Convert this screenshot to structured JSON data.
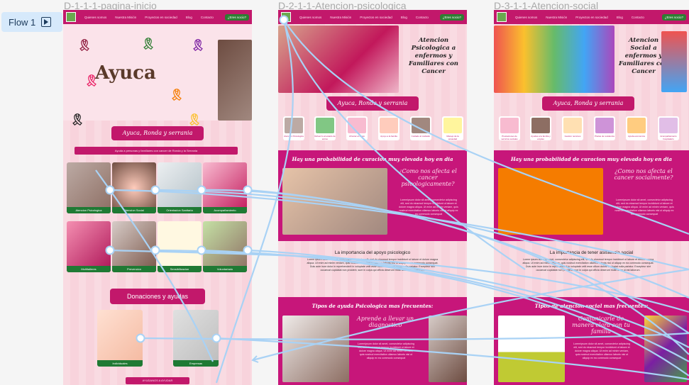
{
  "flow": {
    "label": "Flow 1"
  },
  "frames": {
    "home": {
      "title": "D-1-1-1-pagina-inicio"
    },
    "psych": {
      "title": "D-2-1-1-Atencion-psicologica"
    },
    "social": {
      "title": "D-3-1-1-Atencion-social"
    }
  },
  "nav": {
    "items": [
      "Quienes somos",
      "Nuestra Misión",
      "Proyectos en sociedad",
      "Blog",
      "Contacto"
    ],
    "cta": "¿Eres socio?"
  },
  "home": {
    "logo_text": "Ayuca",
    "banner": "Ayuca, Ronda y serrania",
    "subbanner": "Ayuda a personas y familiares con cancer de Ronda y la Serrania",
    "cards": [
      "Atencion Psicologica",
      "Atencion Social",
      "Orientacion Sanitaria",
      "Acompañamiento",
      "Multitaileres",
      "Prevencion",
      "Sensibilizacion",
      "Voluntariado"
    ],
    "donations_title": "Donaciones y ayudas",
    "donation_cards": [
      "Individuales",
      "Empresas"
    ],
    "footer_button": "AYUDANOS A AYUDAR"
  },
  "psych": {
    "hero_heading": "Atencion Psicologica a enfermos y Familiares con Cancer",
    "banner": "Ayuca, Ronda y serrania",
    "icon_labels": [
      "Atencion Psicologica",
      "Refuerzo al estado de animo",
      "Afrontar el duelo",
      "Apoyo a la familia",
      "Cuidado al cuidador",
      "Manejo de la ansiedad"
    ],
    "section1_title": "Hay una probabilidad de curacion muy elevada hoy en dia",
    "question": "¿Como nos afecta el cancer psicologicamente?",
    "lorem_short": "Loremipsum dolor sit amet, consectetur adipiscing elit, sed do eiusmod tempor incididunt ut labore et dolore magna aliqua. Ut enim ad minim veniam, quis nostrud exercitation ullamco laboris nisi ut aliquip ex ea commodo consequat",
    "section2_title": "La importancia del apoyo psicologico",
    "lorem_long": "Lorem ipsum dolor sit amet, consectetur adipiscing elit, sed do eiusmod tempor incididunt ut labore et dolore magna aliqua. Ut enim ad minim veniam, quis nostrud exercitation ullamco laboris nisi ut aliquip ex ea commodo consequat. Duis aute irure dolor in reprehenderit in voluptate velit esse cillum dolore eu fugiat nulla pariatur. Excepteur sint occaecat cupidatat non proident, sunt in culpa qui officia deserunt mollit anim id est laborum.",
    "section3_title": "Tipos de ayuda Psicologica mas frecuentes:",
    "card_heading": "Aprende a llevar un diagnostico"
  },
  "social": {
    "hero_heading": "Atencion Social a enfermos y Familiares con Cancer",
    "banner": "Ayuca, Ronda y serrania",
    "icon_labels": [
      "Prestaciones de servicios sociales",
      "Ayudas a la familia y empleo",
      "Gestion recursos",
      "Plazas de residencia",
      "Ayuda economica",
      "Acompañamiento hospitalario"
    ],
    "section1_title": "Hay una probabilidad de curacion muy elevada hoy en dia",
    "question": "¿Como nos afecta el cancer socialmente?",
    "section2_title": "La importancia de tener asistencia social",
    "section3_title": "Tipos de atencion social mas frecuentes:",
    "card_heading": "Comunicarle de manera clara con tu familia"
  },
  "colors": {
    "brand_pink": "#c2186b",
    "green": "#1f7a34",
    "connector": "#a9d2f5",
    "frame_bg": "#f8d3dc"
  }
}
